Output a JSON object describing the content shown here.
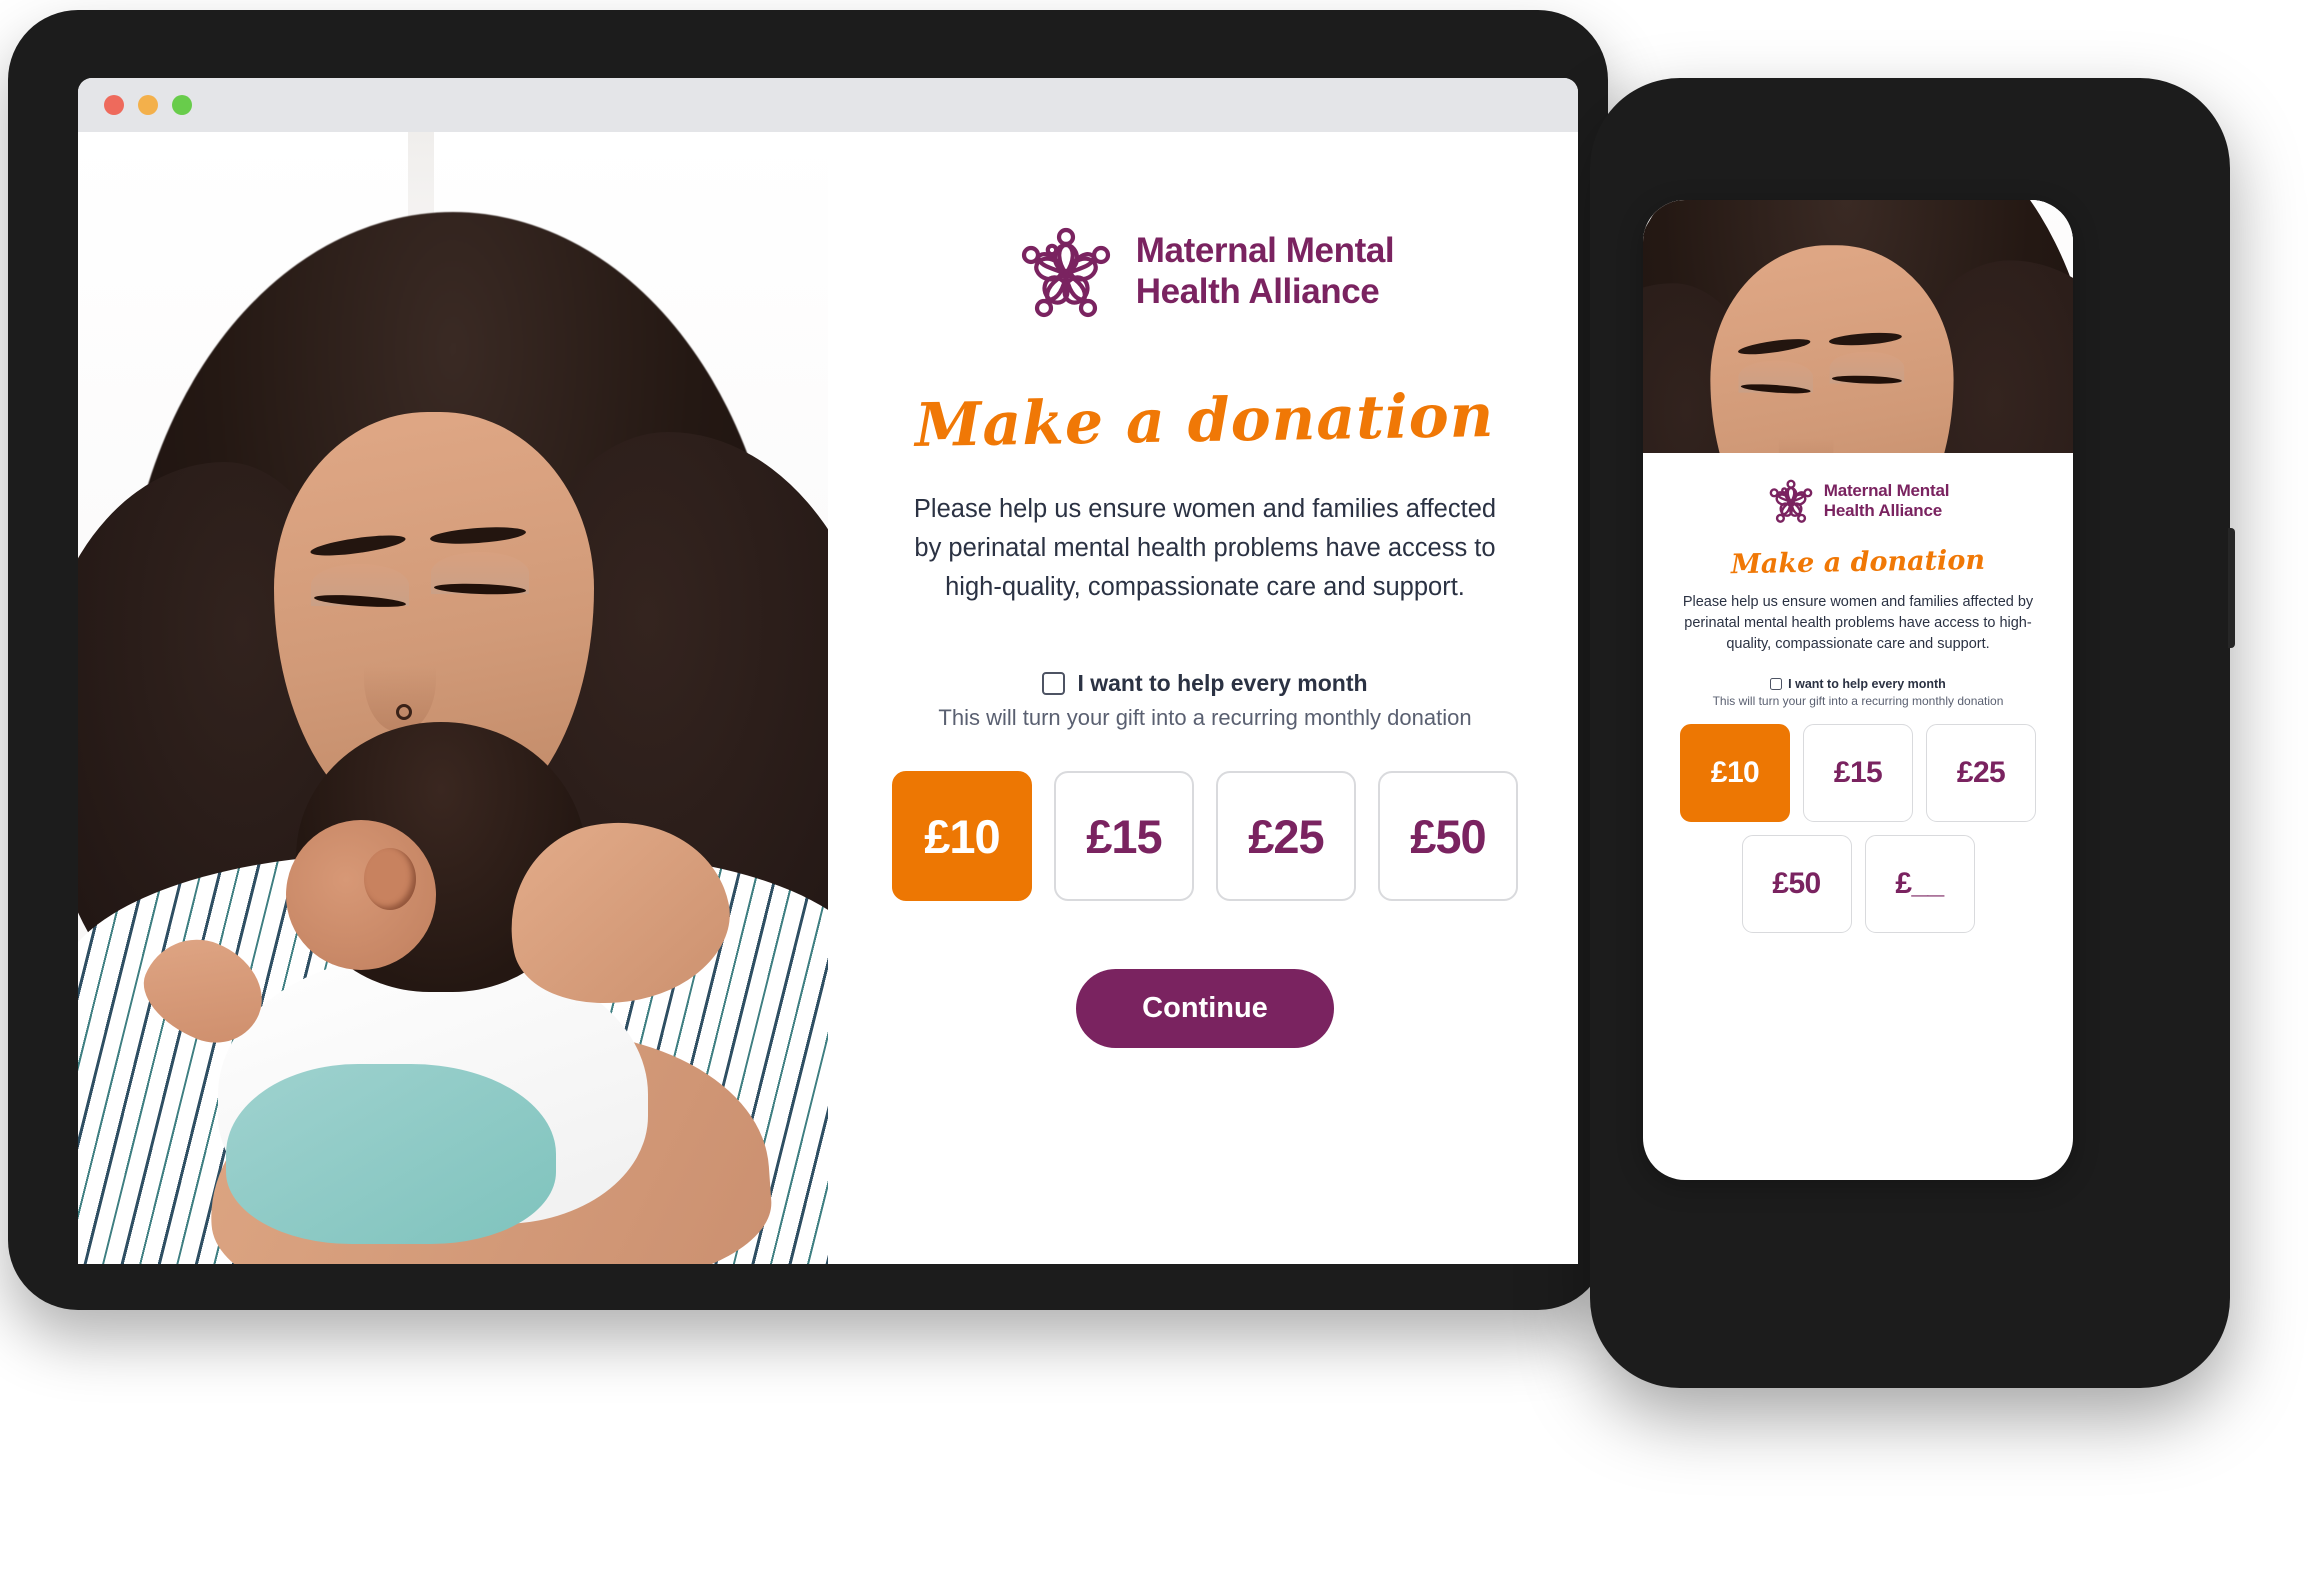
{
  "window": {
    "traffic_lights": [
      "close",
      "minimize",
      "maximize"
    ],
    "colors": {
      "close": "#ee6a5c",
      "minimize": "#f3b04b",
      "maximize": "#68cc4b"
    }
  },
  "brand": {
    "name_line1": "Maternal Mental",
    "name_line2": "Health Alliance",
    "logo_icon": "mmha-knot-logo-icon",
    "purple": "#7A2360",
    "orange": "#ED7703"
  },
  "desktop": {
    "photo_alt": "Mother holding and kissing newborn baby",
    "headline": "Make a donation",
    "intro": "Please help us ensure women and families affected by perinatal mental health problems have access to high-quality, compassionate care and support.",
    "recurring": {
      "checked": false,
      "label": "I want to help every month",
      "sublabel": "This will turn your gift into a recurring monthly donation"
    },
    "amounts": [
      {
        "label": "£10",
        "selected": true
      },
      {
        "label": "£15",
        "selected": false
      },
      {
        "label": "£25",
        "selected": false
      },
      {
        "label": "£50",
        "selected": false
      }
    ],
    "continue_label": "Continue"
  },
  "mobile": {
    "photo_alt": "Mother holding and kissing newborn baby",
    "headline": "Make a donation",
    "intro": "Please help us ensure women and families affected by perinatal mental health problems have access to high-quality, compassionate care and support.",
    "recurring": {
      "checked": false,
      "label": "I want to help every month",
      "sublabel": "This will turn your gift into a recurring monthly donation"
    },
    "amounts": [
      {
        "label": "£10",
        "selected": true
      },
      {
        "label": "£15",
        "selected": false
      },
      {
        "label": "£25",
        "selected": false
      },
      {
        "label": "£50",
        "selected": false
      },
      {
        "label": "£__",
        "selected": false
      }
    ]
  }
}
